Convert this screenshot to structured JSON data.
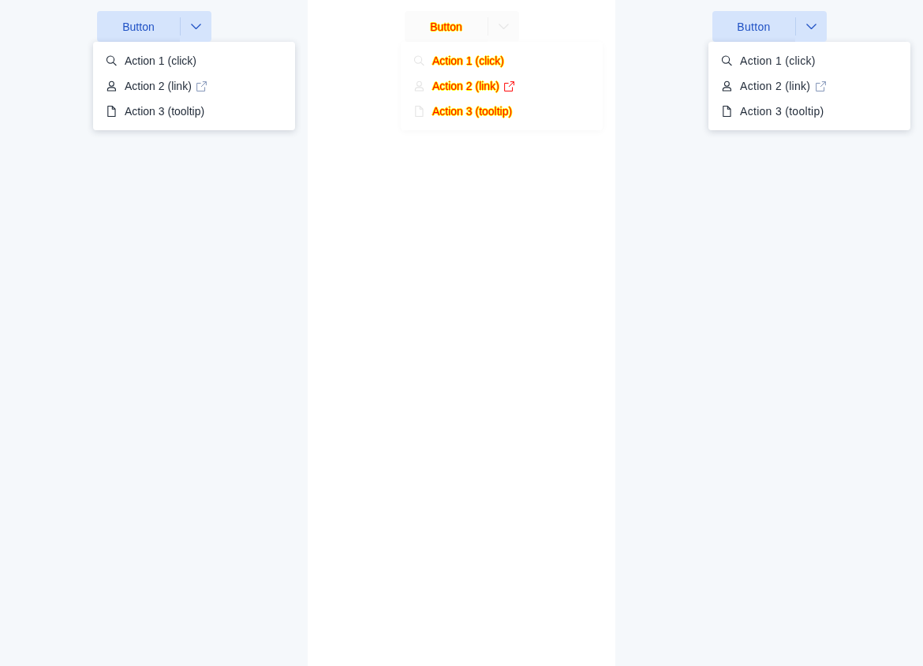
{
  "panels": [
    {
      "kind": "reference",
      "button": {
        "label": "Button"
      },
      "menu": {
        "items": [
          {
            "label": "Action 1 (click)",
            "external": false
          },
          {
            "label": "Action 2 (link)",
            "external": true
          },
          {
            "label": "Action 3 (tooltip)",
            "external": false
          }
        ]
      }
    },
    {
      "kind": "difference",
      "button": {
        "label": "Button"
      },
      "menu": {
        "items": [
          {
            "label": "Action 1 (click)",
            "external": false
          },
          {
            "label": "Action 2 (link)",
            "external": true
          },
          {
            "label": "Action 3 (tooltip)",
            "external": false
          }
        ]
      }
    },
    {
      "kind": "candidate",
      "button": {
        "label": "Button"
      },
      "menu": {
        "items": [
          {
            "label": "Action 1 (click)",
            "external": false
          },
          {
            "label": "Action 2 (link)",
            "external": true
          },
          {
            "label": "Action 3 (tooltip)",
            "external": false
          }
        ]
      }
    }
  ]
}
